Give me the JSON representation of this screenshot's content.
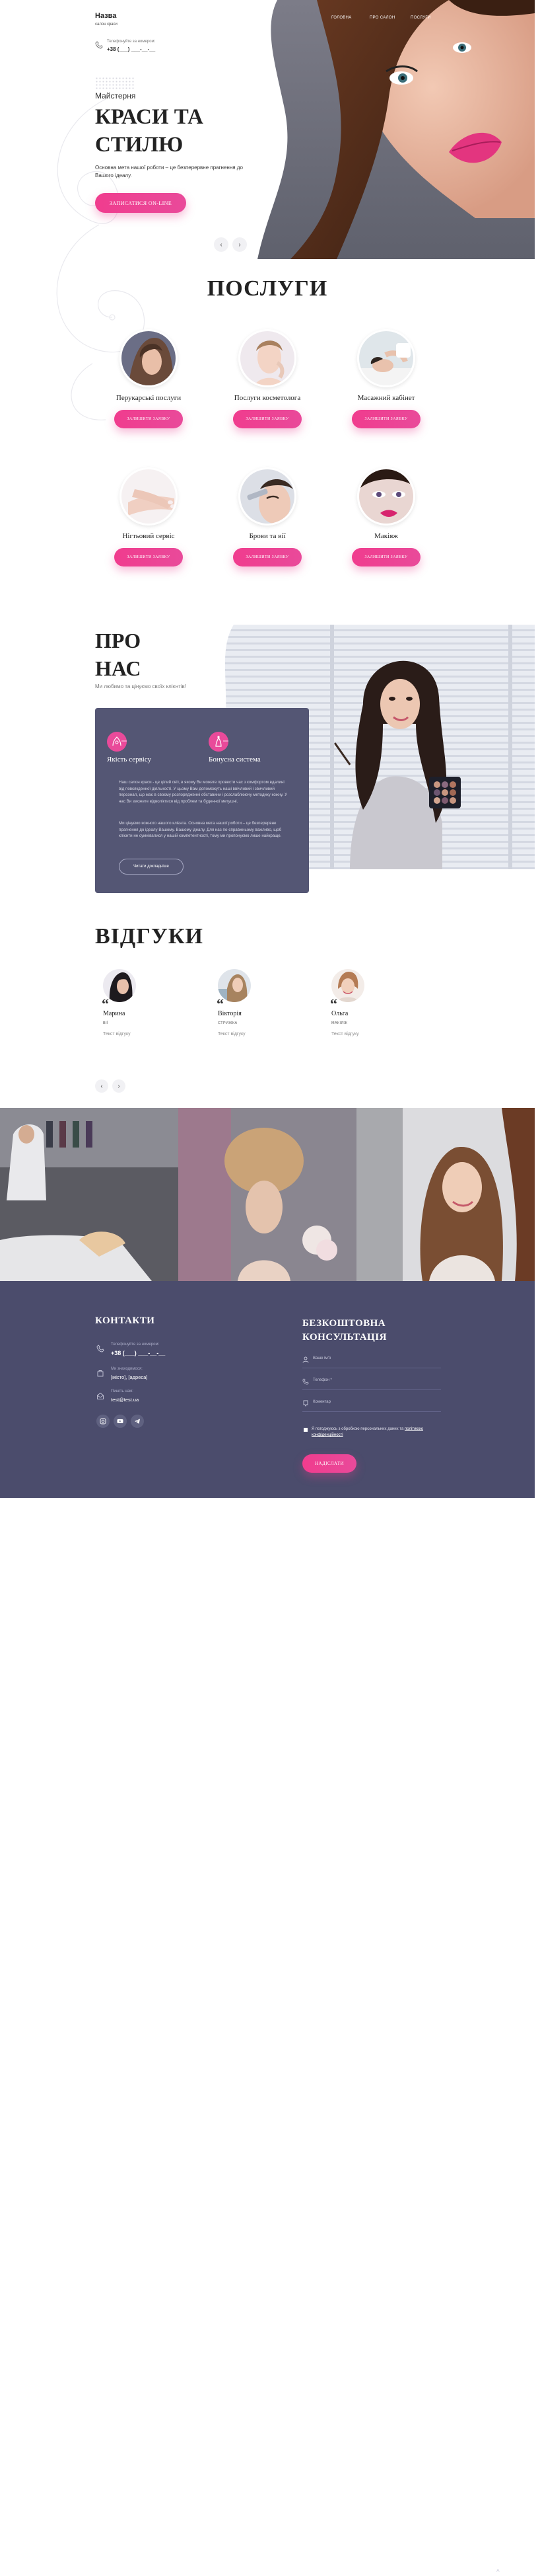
{
  "header": {
    "brand_name": "Назва",
    "brand_sub": "салон краси",
    "phone_caption": "Телефонуйте за номером:",
    "phone_number": "+38 (___) ___-__-__",
    "nav": [
      "ГОЛОВНА",
      "ПРО САЛОН",
      "ПОСЛУГИ"
    ]
  },
  "hero": {
    "subtitle": "Майстерня",
    "title_line1": "КРАСИ ТА",
    "title_line2": "СТИЛЮ",
    "description": "Основна мета нашої роботи – це безперервне прагнення до Вашого ідеалу.",
    "cta_label": "ЗАПИСАТИСЯ ON-LINE",
    "prev_arrow": "‹",
    "next_arrow": "›"
  },
  "services": {
    "title": "ПОСЛУГИ",
    "button_label": "ЗАЛИШИТИ ЗАЯВКУ",
    "items": [
      {
        "name": "Перукарські послуги"
      },
      {
        "name": "Послуги косметолога"
      },
      {
        "name": "Масажний кабінет"
      },
      {
        "name": "Нігтьовий сервіс"
      },
      {
        "name": "Брови та вії"
      },
      {
        "name": "Макіяж"
      }
    ]
  },
  "about": {
    "title_line1": "ПРО",
    "title_line2": "НАС",
    "subtitle": "Ми любимо та цінуємо своїх клієнтів!",
    "feature1": "Якість сервісу",
    "feature2": "Бонусна система",
    "paragraph1": "Наш салон краси - це цілий світ, в якому Ви можете провести час з комфортом вдалині від повсякденної діяльності. У цьому Вам допоможуть наші ввічливий і звичливий персонал, що має в своєму розпорядженні обставини і розслаблюючу методику кожну. У нас Ви зможете відволіктися від проблем та буденної метушні.",
    "paragraph2": "Ми цінуємо кожного нашого клієнта. Основна мета нашої роботи – це безперервне прагнення до ідеалу Вашому. Вашому ідеалу. Для нас по-справжньому важливо, щоб клієнти не сумнівалися у нашій компетентності, тому ми пропонуємо лише найкраще.",
    "button_label": "Читати докладніше"
  },
  "reviews": {
    "title": "ВІДГУКИ",
    "items": [
      {
        "name": "Марина",
        "role": "ВІЇ",
        "text": "Текст відгуку"
      },
      {
        "name": "Вікторія",
        "role": "СТРИЖКА",
        "text": "Текст відгуку"
      },
      {
        "name": "Ольга",
        "role": "МАКІЯЖ",
        "text": "Текст відгуку"
      }
    ],
    "prev_arrow": "‹",
    "next_arrow": "›"
  },
  "contacts": {
    "title": "КОНТАКТИ",
    "phone_caption": "Телефонуйте за номером:",
    "phone_value": "+38 (___) ___-__-__",
    "address_caption": "Ми знаходимося:",
    "address_value": "[місто], [адреса]",
    "email_caption": "Пишіть нам:",
    "email_value": "test@test.ua",
    "to_top": "^"
  },
  "consultation": {
    "title_line1": "БЕЗКОШТОВНА",
    "title_line2": "КОНСУЛЬТАЦІЯ",
    "name_placeholder": "Ваше ім'я",
    "phone_placeholder": "Телефон *",
    "comment_placeholder": "Коментар",
    "agree_text": "Я погоджуюсь з обробкою персональних даних та",
    "agree_link": "політикою конфіденційності",
    "submit_label": "НАДІСЛАТИ"
  },
  "colors": {
    "accent_pink": "#e94a9a",
    "dark_slate": "#4b4c6c",
    "card_slate": "#545674"
  }
}
